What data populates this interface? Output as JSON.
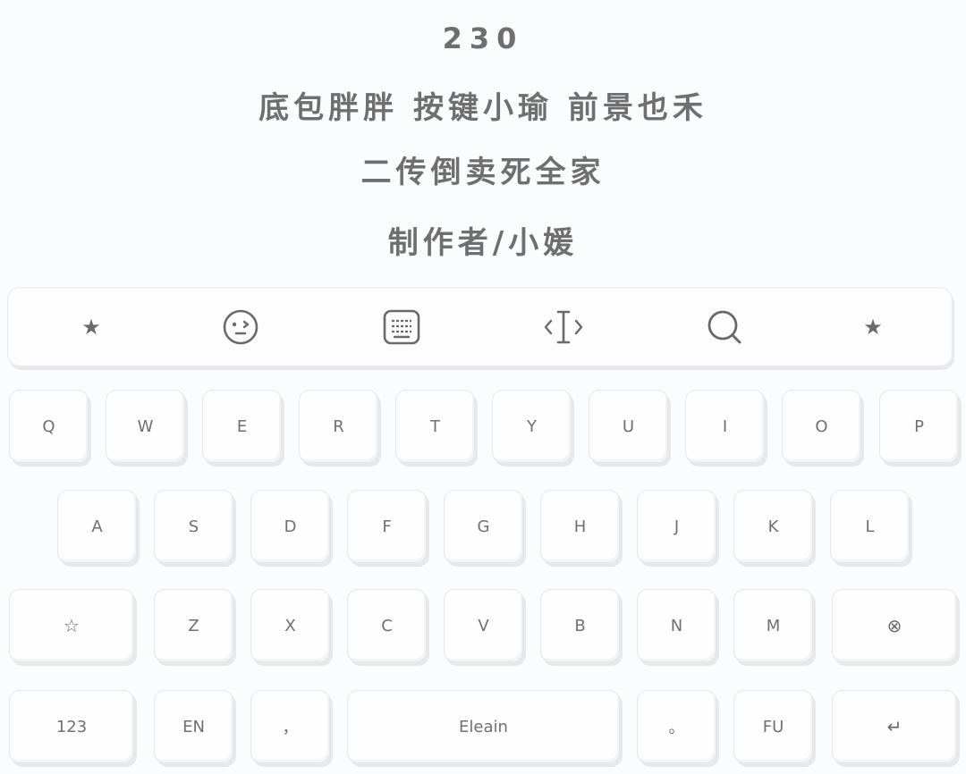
{
  "header": {
    "code": "230",
    "credits": "底包胖胖 按键小瑜 前景也禾",
    "slogan": "二传倒卖死全家",
    "author": "制作者/小媛"
  },
  "toolbar": {
    "left_star": "★",
    "right_star": "★",
    "icons": [
      "star-icon",
      "emoji-face-icon",
      "keyboard-icon",
      "cursor-move-icon",
      "search-icon",
      "star-icon"
    ]
  },
  "keyboard": {
    "row1": [
      "Q",
      "W",
      "E",
      "R",
      "T",
      "Y",
      "U",
      "I",
      "O",
      "P"
    ],
    "row2": [
      "A",
      "S",
      "D",
      "F",
      "G",
      "H",
      "J",
      "K",
      "L"
    ],
    "row3": {
      "shift": "☆",
      "letters": [
        "Z",
        "X",
        "C",
        "V",
        "B",
        "N",
        "M"
      ],
      "delete": "⊗"
    },
    "row4": {
      "numbers": "123",
      "lang": "EN",
      "comma": "，",
      "space": "Eleain",
      "period": "。",
      "fu": "FU",
      "enter": "↵"
    }
  }
}
